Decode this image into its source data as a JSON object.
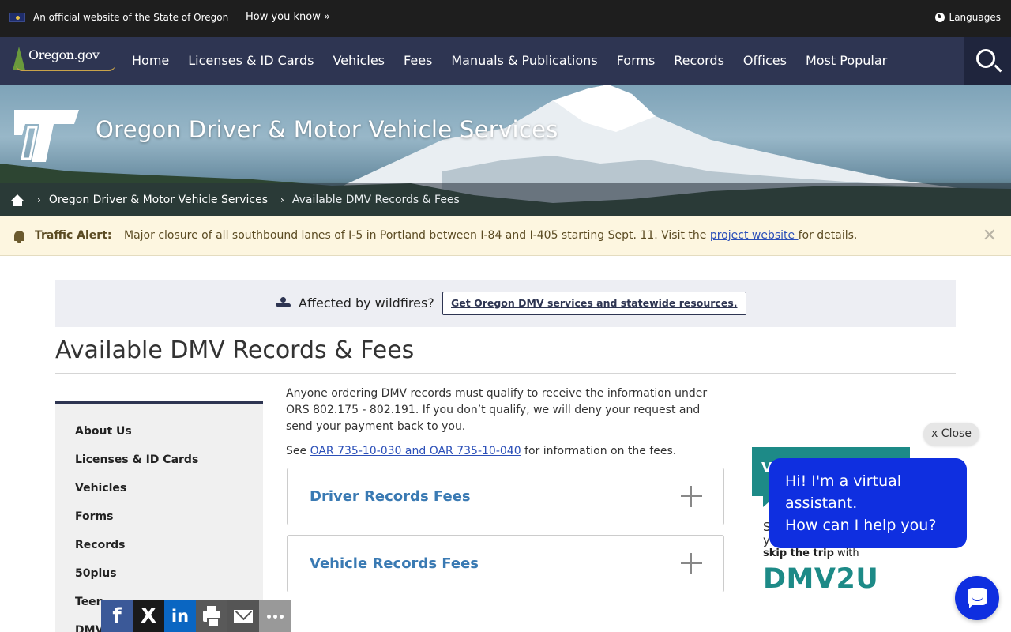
{
  "official_bar": {
    "text": "An official website of the State of Oregon",
    "how_link": "How you know »",
    "languages": "Languages"
  },
  "nav": {
    "logo_text": "Oregon.gov",
    "items": [
      "Home",
      "Licenses & ID Cards",
      "Vehicles",
      "Fees",
      "Manuals & Publications",
      "Forms",
      "Records",
      "Offices",
      "Most Popular"
    ]
  },
  "hero": {
    "agency_title": "Oregon Driver & Motor Vehicle Services"
  },
  "breadcrumb": {
    "items": [
      "Oregon Driver & Motor Vehicle Services",
      "Available DMV Records & Fees"
    ]
  },
  "alert": {
    "label": "Traffic Alert:",
    "text_before": "Major closure of all southbound lanes of I-5 in Portland between I-84 and I-405 starting Sept. 11. Visit the ",
    "link": "project website ",
    "text_after": "for details.",
    "close": "✕"
  },
  "wildfire": {
    "text": "Affected by wildfires?",
    "button": "Get Oregon DMV services and statewide resources."
  },
  "page_title": "Available DMV Records & Fees",
  "sidebar": {
    "items": [
      "About Us",
      "Licenses & ID Cards",
      "Vehicles",
      "Forms",
      "Records",
      "50plus",
      "Teen",
      "DMV"
    ]
  },
  "content": {
    "intro": "Anyone ordering DMV records must qualify to receive the information under ORS 802.175 - 802.191. If you don’t qualify, we will deny your request and send your payment back to you.",
    "see_prefix": "See ",
    "see_link": "OAR 735-10-030 and OAR 735-10-040",
    "see_suffix": " for information on the fees.",
    "accordions": [
      "Driver Records Fees",
      "Vehicle Records Fees"
    ]
  },
  "promo": {
    "teal_text": "V",
    "line1": "S",
    "line2": "y",
    "skip_bold": "skip the trip",
    "skip_rest": " with",
    "brand": "DMV2U"
  },
  "chat": {
    "close": "x Close",
    "lines": [
      "Hi! I'm a virtual",
      "assistant.",
      "How can I help you?"
    ]
  },
  "share": {
    "facebook": "f",
    "x": "X",
    "linkedin": "in"
  },
  "colors": {
    "nav_bg": "#2e3552",
    "alert_bg": "#fdf6e0",
    "accent_link": "#2b4fb8",
    "accordion_title": "#3a7ab3",
    "chat_blue": "#0f2fe0",
    "promo_teal": "#1d8a87"
  }
}
